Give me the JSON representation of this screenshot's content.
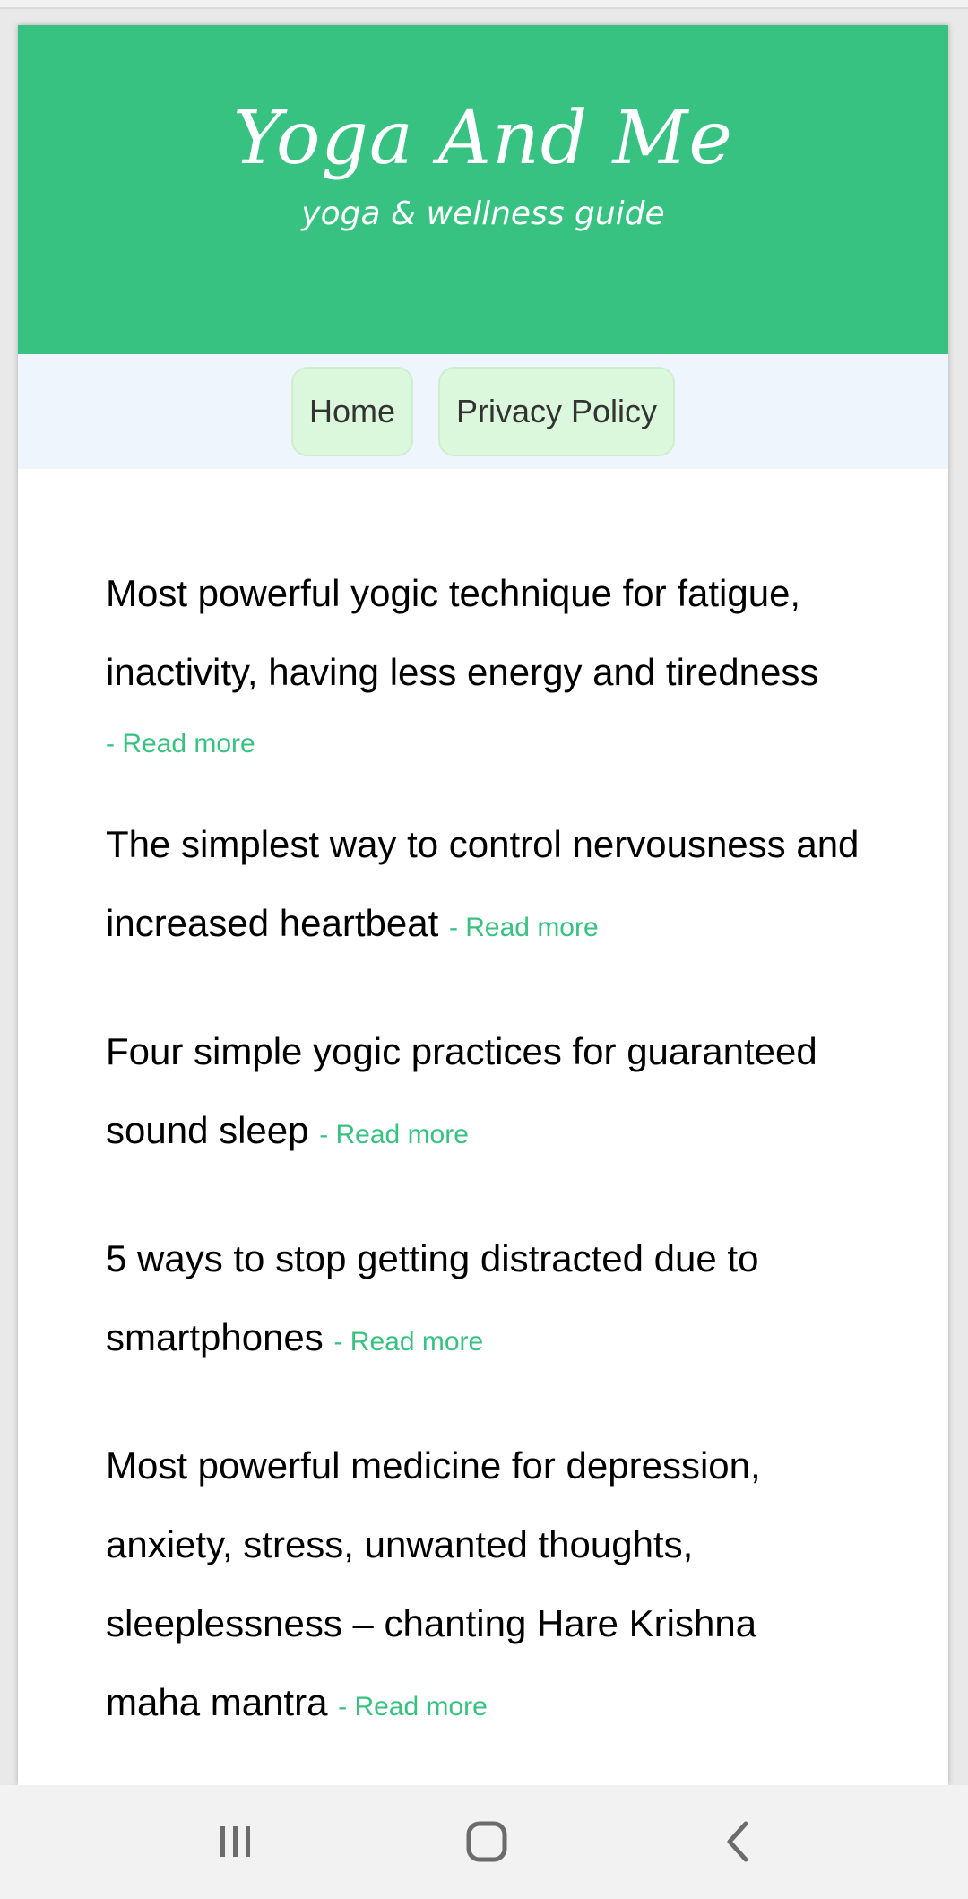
{
  "header": {
    "title": "Yoga And Me",
    "tagline": "yoga & wellness guide"
  },
  "nav": {
    "items": [
      "Home",
      "Privacy Policy"
    ]
  },
  "posts": [
    {
      "title": "Most powerful yogic technique for fatigue, inactivity, having less energy and tiredness",
      "link": "- Read more"
    },
    {
      "title": "The simplest way to control nervousness and increased heartbeat",
      "link": "- Read more"
    },
    {
      "title": "Four simple yogic practices for guaranteed sound sleep",
      "link": "- Read more"
    },
    {
      "title": "5 ways to stop getting distracted due to smartphones",
      "link": "- Read more"
    },
    {
      "title": "Most powerful medicine for depression, anxiety, stress, unwanted thoughts, sleeplessness – chanting Hare Krishna maha mantra",
      "link": "- Read more"
    }
  ],
  "system_nav": {
    "icons": [
      "recent-apps-icon",
      "home-icon",
      "back-icon"
    ]
  },
  "colors": {
    "accent": "#38c282",
    "nav_bg": "#eef5fd",
    "button_bg": "#dcf8dc"
  }
}
